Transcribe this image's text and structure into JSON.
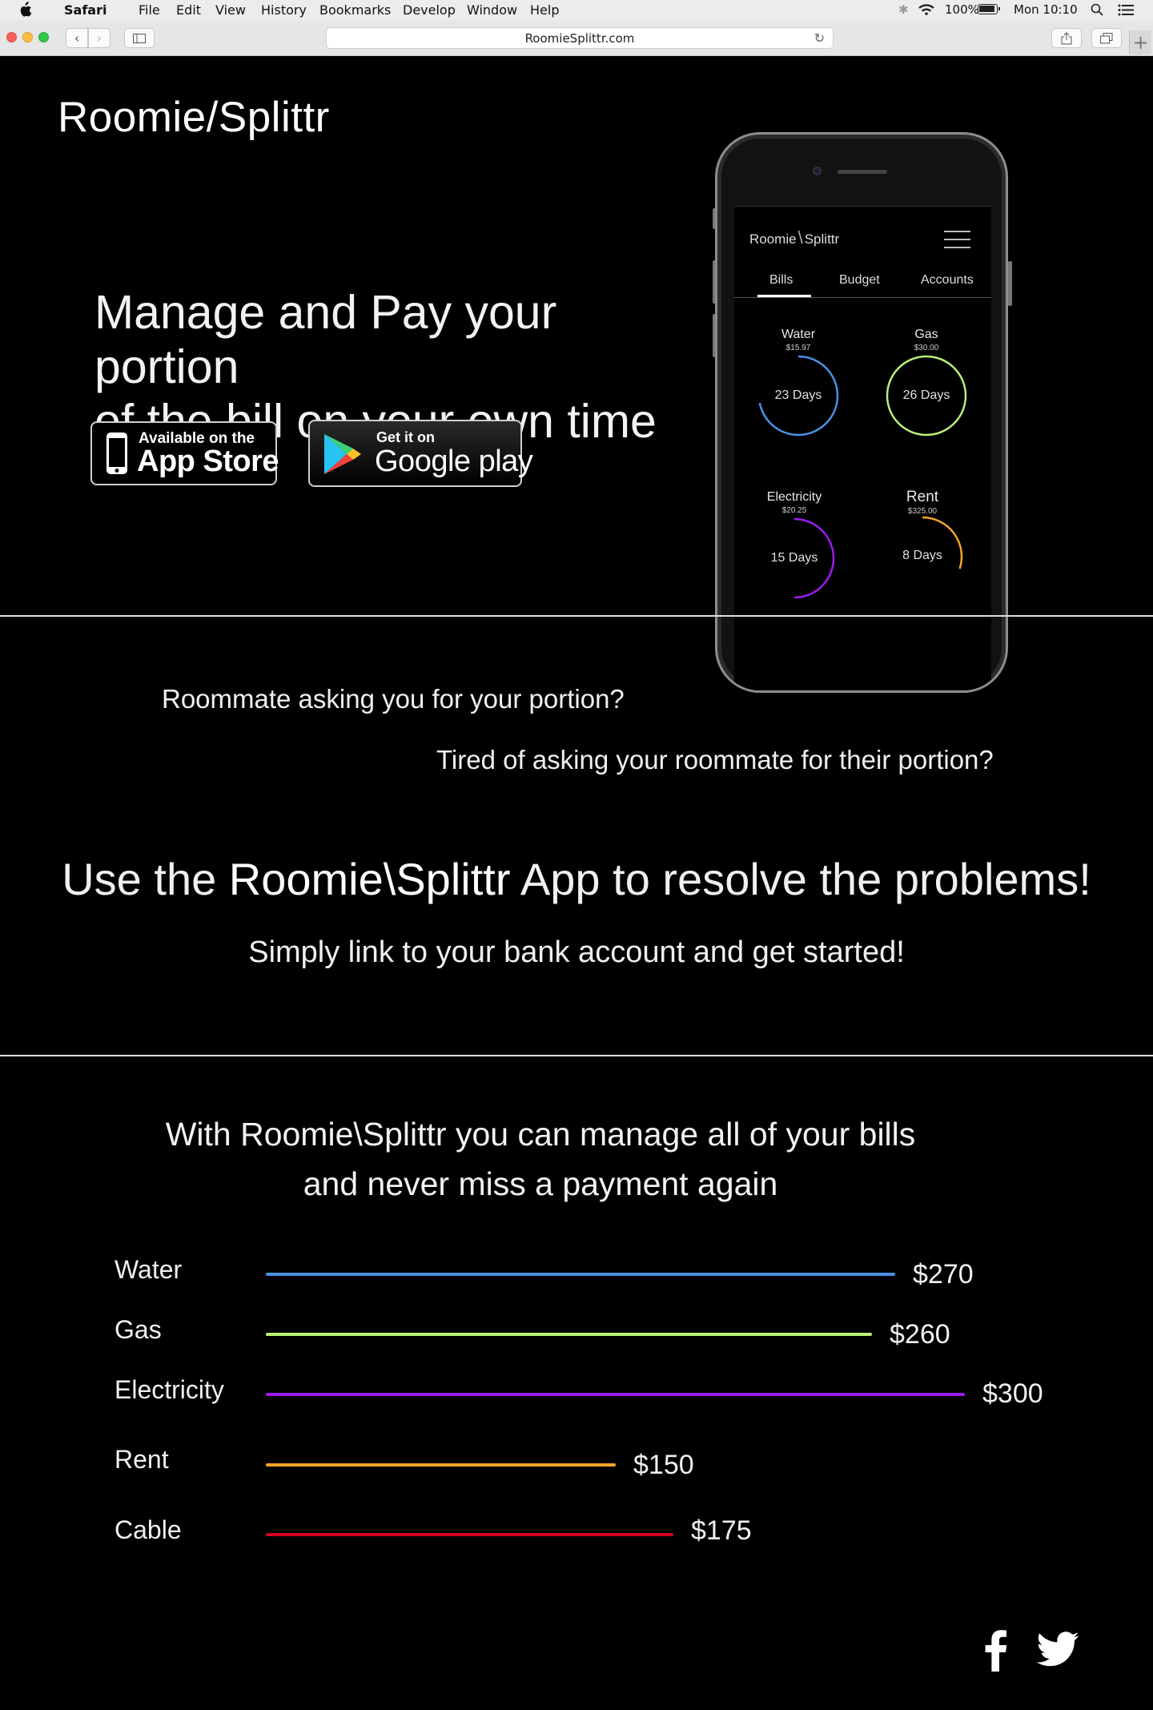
{
  "menubar": {
    "app_name": "Safari",
    "items": [
      "File",
      "Edit",
      "View",
      "History",
      "Bookmarks",
      "Develop",
      "Window",
      "Help"
    ],
    "battery": "100%",
    "clock": "Mon 10:10"
  },
  "browser": {
    "url": "RoomieSplittr.com"
  },
  "hero": {
    "brand": "Roomie/Splittr",
    "title_line1": "Manage and Pay your portion",
    "title_line2": "of the bill on your own time",
    "appstore": {
      "small": "Available on the",
      "big": "App Store"
    },
    "googleplay": {
      "small": "Get it on",
      "big": "Google play"
    }
  },
  "phone_app": {
    "logo_part1": "Roomie",
    "logo_part2": "Splittr",
    "tabs": [
      "Bills",
      "Budget",
      "Accounts"
    ],
    "bills": [
      {
        "name": "Water",
        "amount": "$15.97",
        "days": "23 Days",
        "color": "#4a90e2",
        "progress": 0.72
      },
      {
        "name": "Gas",
        "amount": "$30.00",
        "days": "26 Days",
        "color": "#b8f07a",
        "progress": 1.0
      },
      {
        "name": "Electricity",
        "amount": "$20.25",
        "days": "15 Days",
        "color": "#9b1cf0",
        "progress": 0.5
      },
      {
        "name": "Rent",
        "amount": "$325.00",
        "days": "8 Days",
        "color": "#f5a623",
        "progress": 0.3
      }
    ]
  },
  "problem": {
    "question1": "Roommate asking you for your portion?",
    "question2": "Tired of asking your roommate for their portion?",
    "headline_pre": "Use the ",
    "headline_brand": "Roomie\\Splittr",
    "headline_post": " App to resolve the problems!",
    "subline": "Simply link to your bank account and get started!"
  },
  "bills_section": {
    "title_line1": "With Roomie\\Splittr you can manage all of your bills",
    "title_line2": "and never miss a payment again",
    "bars": [
      {
        "label": "Water",
        "value": 270,
        "display": "$270",
        "color": "#4a90e2"
      },
      {
        "label": "Gas",
        "value": 260,
        "display": "$260",
        "color": "#b8f07a"
      },
      {
        "label": "Electricity",
        "value": 300,
        "display": "$300",
        "color": "#9b1cf0"
      },
      {
        "label": "Rent",
        "value": 150,
        "display": "$150",
        "color": "#f5a623"
      },
      {
        "label": "Cable",
        "value": 175,
        "display": "$175",
        "color": "#d0021b"
      }
    ]
  },
  "footer": {
    "social": [
      "facebook-icon",
      "twitter-icon"
    ]
  }
}
